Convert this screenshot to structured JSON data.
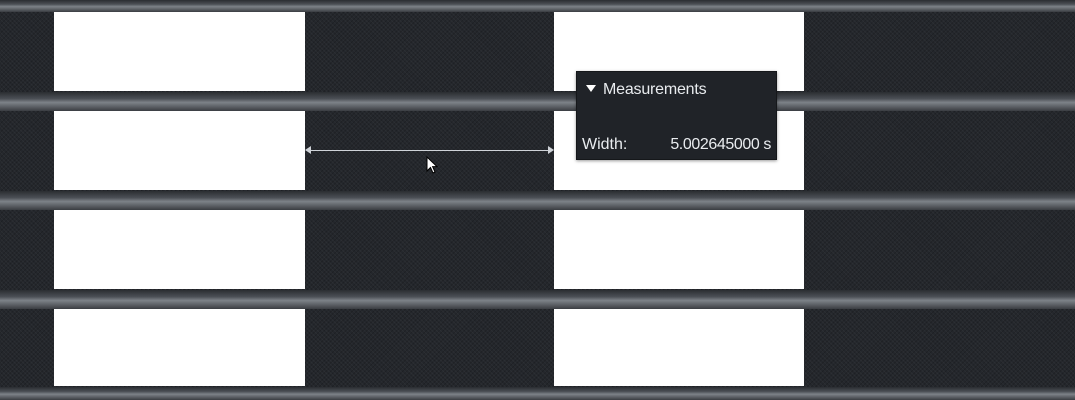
{
  "measurements_panel": {
    "title": "Measurements",
    "width_label": "Width:",
    "width_value": "5.002645000 s"
  },
  "icons": [
    "disclosure-triangle-icon",
    "mouse-pointer-icon",
    "double-headed-arrow-icon"
  ],
  "colors": {
    "signal_high": "#ffffff",
    "signal_low": "#24272c",
    "panel_background": "#202328",
    "measure_line": "#cfd3d8"
  }
}
